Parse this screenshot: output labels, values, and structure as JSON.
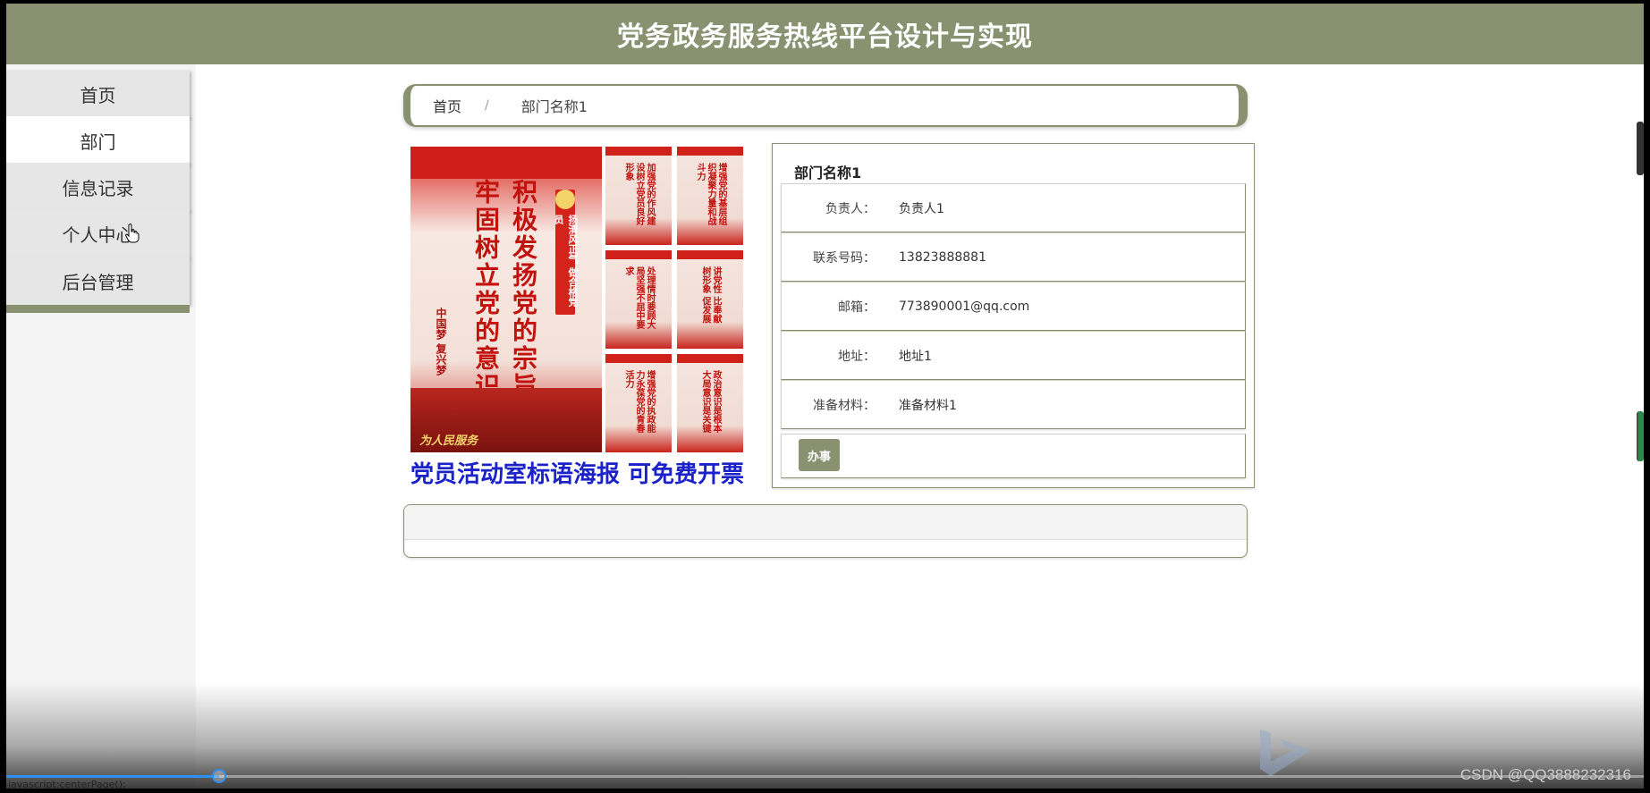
{
  "header": {
    "title": "党务政务服务热线平台设计与实现"
  },
  "sidebar": {
    "items": [
      {
        "label": "首页"
      },
      {
        "label": "部门"
      },
      {
        "label": "信息记录"
      },
      {
        "label": "个人中心"
      },
      {
        "label": "后台管理"
      }
    ],
    "active_index": 1
  },
  "breadcrumb": {
    "home": "首页",
    "separator": "/",
    "current": "部门名称1"
  },
  "poster": {
    "vertical_text_1": "积极发扬党的宗旨",
    "vertical_text_2": "牢固树立党的意识",
    "badge": "扬清风正气 做合格党员",
    "dream": "中国梦 复兴梦",
    "gate_sign": "为人民服务",
    "cards": [
      "加强党的作风建设树立党员良好形象",
      "增强党的基层组织凝聚力量和战斗力",
      "处理情时要顾大局坚强不屈中要求",
      "讲党性 比奉献树形象 促发展",
      "增强党的执政能力永葆党的青春活力",
      "政治意识是根本大局意识是关键"
    ],
    "caption": "党员活动室标语海报 可免费开票"
  },
  "detail": {
    "title": "部门名称1",
    "rows": [
      {
        "label": "负责人：",
        "value": "负责人1"
      },
      {
        "label": "联系号码：",
        "value": "13823888881"
      },
      {
        "label": "邮箱：",
        "value": "773890001@qq.com"
      },
      {
        "label": "地址：",
        "value": "地址1"
      },
      {
        "label": "准备材料：",
        "value": "准备材料1"
      }
    ],
    "action_label": "办事"
  },
  "overlay": {
    "status_text": "javascript:centerPage();",
    "watermark": "CSDN @QQ3888232316",
    "video_progress": 0.13
  },
  "colors": {
    "accent": "#8a9170",
    "caption_blue": "#1a22c8",
    "poster_red": "#c1120d"
  }
}
